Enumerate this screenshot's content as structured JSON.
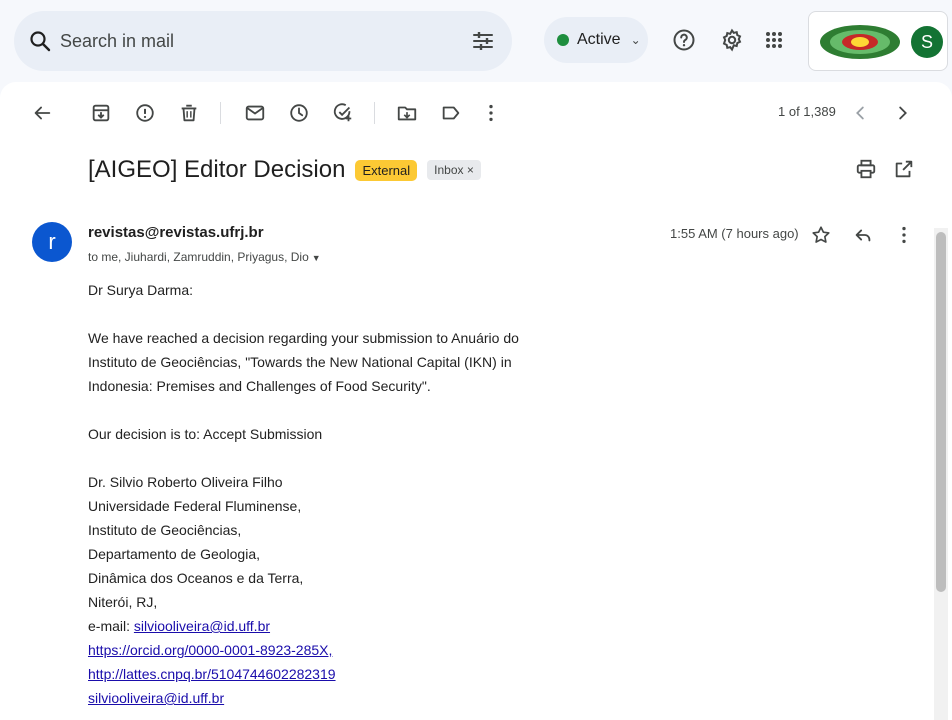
{
  "search": {
    "placeholder": "Search in mail"
  },
  "status": {
    "label": "Active",
    "color": "#1e8e3e"
  },
  "account": {
    "initial": "S"
  },
  "toolbar": {
    "pager": "1 of 1,389"
  },
  "email": {
    "subject": "[AIGEO] Editor Decision",
    "labels": {
      "external": "External",
      "inbox": "Inbox ×"
    },
    "sender_initial": "r",
    "sender": "revistas@revistas.ufrj.br",
    "recipients": "to me, Jiuhardi, Zamruddin, Priyagus, Dio",
    "time": "1:55 AM (7 hours ago)",
    "greeting": "Dr Surya Darma:",
    "paragraph1": [
      "We have reached a decision regarding your submission to Anuário do",
      "Instituto de Geociências, \"Towards the New National Capital (IKN) in",
      "Indonesia: Premises and Challenges of Food Security\"."
    ],
    "decision": "Our decision is to: Accept Submission",
    "signature": [
      "Dr. Silvio Roberto Oliveira Filho",
      "Universidade Federal Fluminense,",
      "Instituto de Geociências,",
      "Departamento de Geologia,",
      "Dinâmica dos Oceanos e da Terra,",
      "Niterói, RJ,"
    ],
    "email_prefix": "e-mail: ",
    "email_link": "silviooliveira@id.uff.br",
    "orcid": "https://orcid.org/0000-0001-8923-285X,",
    "lattes": "http://lattes.cnpq.br/5104744602282319",
    "email_link2": "silviooliveira@id.uff.br"
  }
}
